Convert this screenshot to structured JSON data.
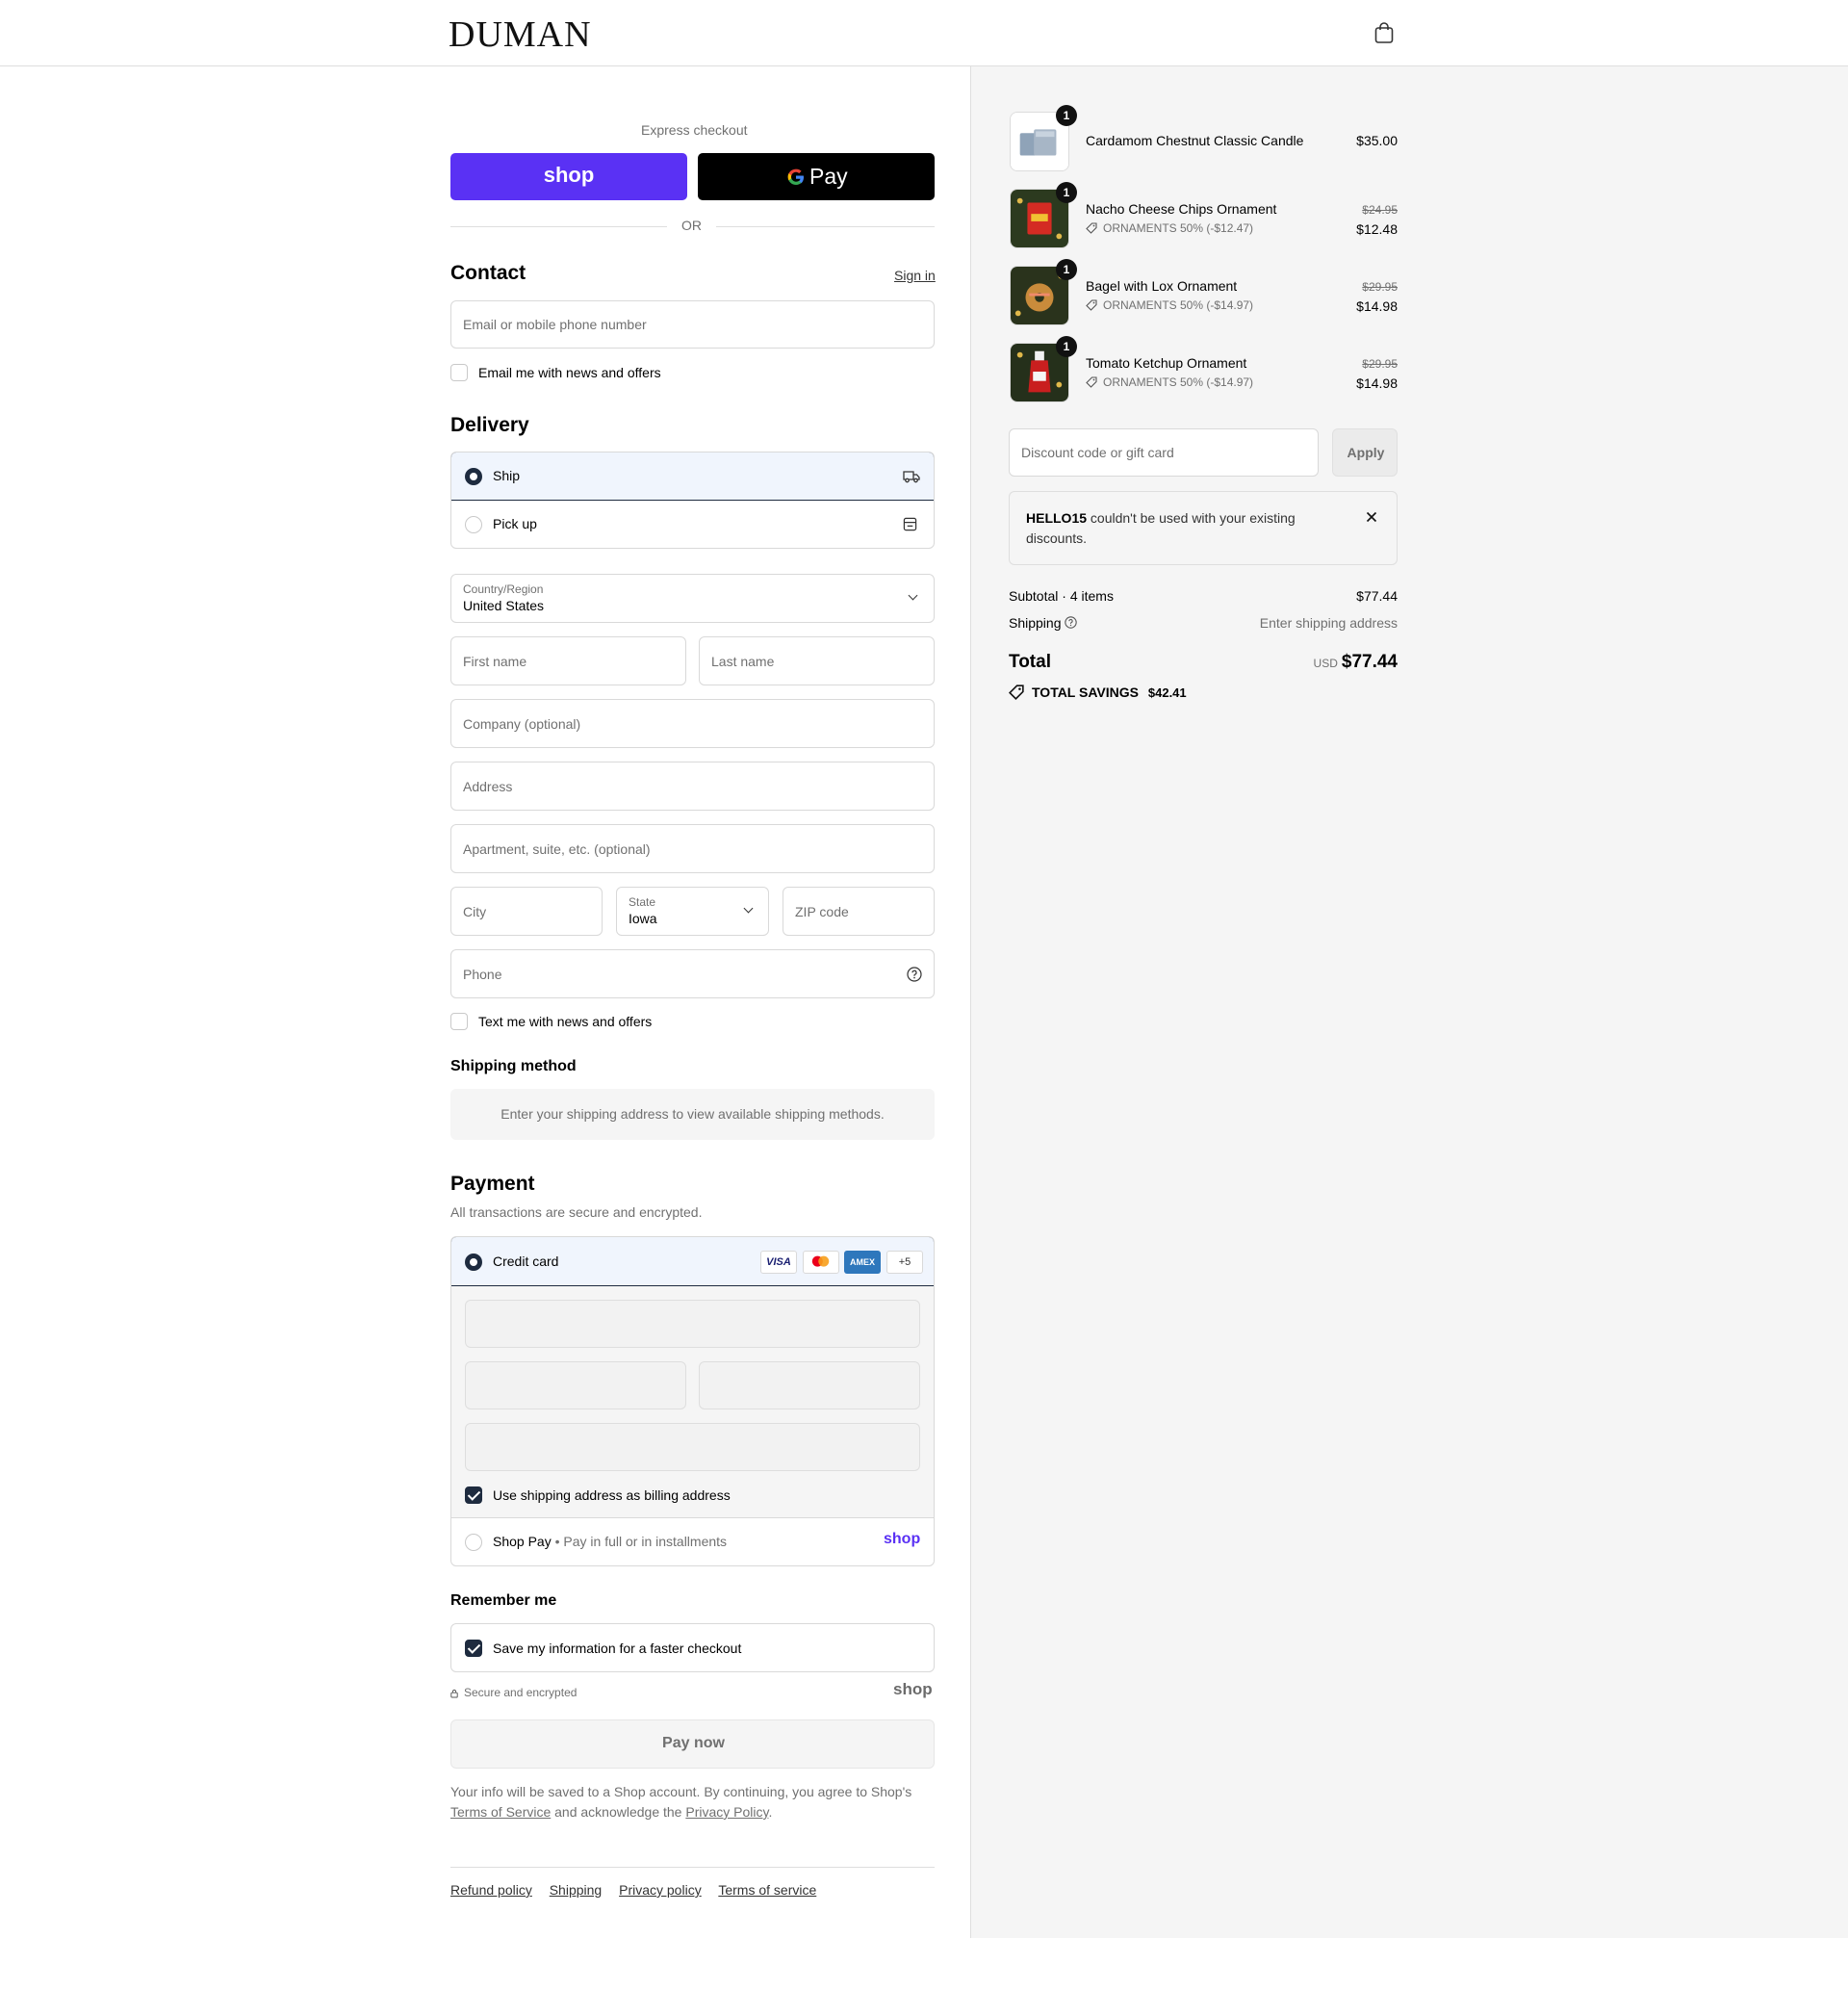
{
  "header": {
    "logo": "DUMAN",
    "cart_icon": "shopping-bag-icon"
  },
  "express": {
    "title": "Express checkout",
    "shop_label": "shop",
    "gpay_label": "Pay",
    "or_label": "OR"
  },
  "contact": {
    "title": "Contact",
    "sign_in": "Sign in",
    "email_placeholder": "Email or mobile phone number",
    "news_label": "Email me with news and offers"
  },
  "delivery": {
    "title": "Delivery",
    "options": [
      {
        "label": "Ship",
        "icon": "truck-icon",
        "selected": true
      },
      {
        "label": "Pick up",
        "icon": "store-icon",
        "selected": false
      }
    ],
    "country_label": "Country/Region",
    "country_value": "United States",
    "first_name": "First name",
    "last_name": "Last name",
    "company": "Company (optional)",
    "address": "Address",
    "apartment": "Apartment, suite, etc. (optional)",
    "city": "City",
    "state_label": "State",
    "state_value": "Iowa",
    "zip": "ZIP code",
    "phone": "Phone",
    "text_label": "Text me with news and offers"
  },
  "shipping_method": {
    "title": "Shipping method",
    "message": "Enter your shipping address to view available shipping methods."
  },
  "payment": {
    "title": "Payment",
    "subtitle": "All transactions are secure and encrypted.",
    "credit_card_label": "Credit card",
    "card_brands": [
      "VISA",
      "mastercard",
      "AMEX"
    ],
    "more_brands": "+5",
    "billing_label": "Use shipping address as billing address",
    "shop_pay_label": "Shop Pay",
    "shop_pay_sub": "Pay in full or in installments",
    "shop_pay_logo": "shop"
  },
  "remember": {
    "title": "Remember me",
    "save_label": "Save my information for a faster checkout",
    "secure_label": "Secure and encrypted",
    "shop_logo": "shop"
  },
  "pay_button": "Pay now",
  "legal": {
    "line1": "Your info will be saved to a Shop account. By continuing, you agree to Shop's",
    "tos": "Terms of Service",
    "middle": "and acknowledge the",
    "privacy": "Privacy Policy",
    "end": "."
  },
  "footer_links": [
    "Refund policy",
    "Shipping",
    "Privacy policy",
    "Terms of service"
  ],
  "cart": {
    "items": [
      {
        "name": "Cardamom Chestnut Classic Candle",
        "qty": "1",
        "price": "$35.00",
        "old_price": "",
        "discount": ""
      },
      {
        "name": "Nacho Cheese Chips Ornament",
        "qty": "1",
        "price": "$12.48",
        "old_price": "$24.95",
        "discount": "ORNAMENTS 50% (-$12.47)"
      },
      {
        "name": "Bagel with Lox Ornament",
        "qty": "1",
        "price": "$14.98",
        "old_price": "$29.95",
        "discount": "ORNAMENTS 50% (-$14.97)"
      },
      {
        "name": "Tomato Ketchup Ornament",
        "qty": "1",
        "price": "$14.98",
        "old_price": "$29.95",
        "discount": "ORNAMENTS 50% (-$14.97)"
      }
    ],
    "discount_placeholder": "Discount code or gift card",
    "apply": "Apply",
    "error_code": "HELLO15",
    "error_text": "couldn't be used with your existing discounts.",
    "subtotal_label": "Subtotal · 4 items",
    "subtotal": "$77.44",
    "shipping_label": "Shipping",
    "shipping_value": "Enter shipping address",
    "total_label": "Total",
    "currency": "USD",
    "total": "$77.44",
    "savings_label": "TOTAL SAVINGS",
    "savings": "$42.41"
  },
  "colors": {
    "shop_purple": "#5a31f4",
    "accent_dark": "#1e2b3f",
    "panel_bg": "#f5f5f5"
  }
}
